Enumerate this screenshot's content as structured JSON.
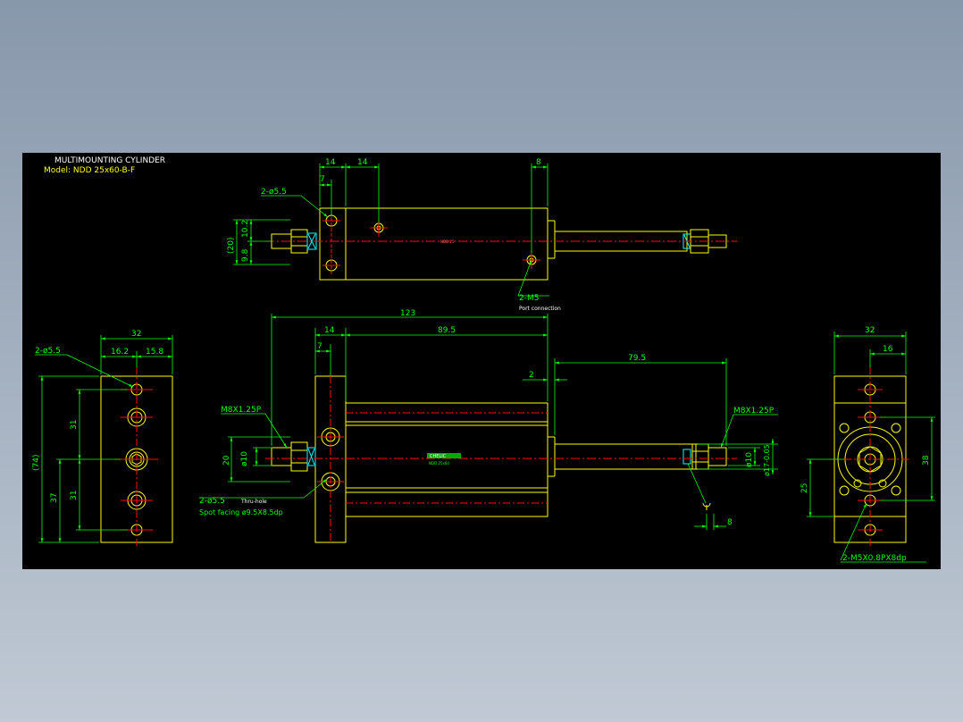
{
  "title_block": {
    "title": "MULTIMOUNTING CYLINDER",
    "model": "Model: NDD 25x60-B-F"
  },
  "top_view": {
    "dim_14_a": "14",
    "dim_14_b": "14",
    "dim_7": "7",
    "dim_8": "8",
    "hole_callout": "2-ø5.5",
    "dim_20": "(20)",
    "dim_10_2": "10.2",
    "dim_9_8": "9.8",
    "center_mark": "NDD 25",
    "port_callout": "2-M5",
    "port_note": "Port connection"
  },
  "front_view": {
    "dim_123": "123",
    "dim_14": "14",
    "dim_7": "7",
    "dim_89_5": "89.5",
    "dim_79_5": "79.5",
    "dim_2": "2",
    "thread_left": "M8X1.25P",
    "thread_right": "M8X1.25P",
    "dim_20": "20",
    "dim_d10_left": "ø10",
    "dim_d10_right": "ø10",
    "dim_d17": "ø17-0.05",
    "hole_callout": "2-ø5.5",
    "thru_note": "Thru-hole",
    "spot_note": "Spot facing  ø9.5X8.5dp",
    "dim_8": "8",
    "brand": "CHELIC",
    "brand_sub": "NDD 25x60"
  },
  "left_view": {
    "dim_32": "32",
    "dim_16_2": "16.2",
    "dim_15_8": "15.8",
    "hole_callout": "2-ø5.5",
    "dim_74": "(74)",
    "dim_31_a": "31",
    "dim_31_b": "31",
    "dim_37": "37"
  },
  "right_view": {
    "dim_32": "32",
    "dim_16": "16",
    "dim_38": "38",
    "dim_25": "25",
    "thread_callout": "2-M5X0.8PX8dp"
  },
  "colors": {
    "canvas_bg": "#000000",
    "outline": "#ffff00",
    "dimension": "#00ff00",
    "centerline": "#ff0000",
    "hatch": "#00ffff"
  }
}
